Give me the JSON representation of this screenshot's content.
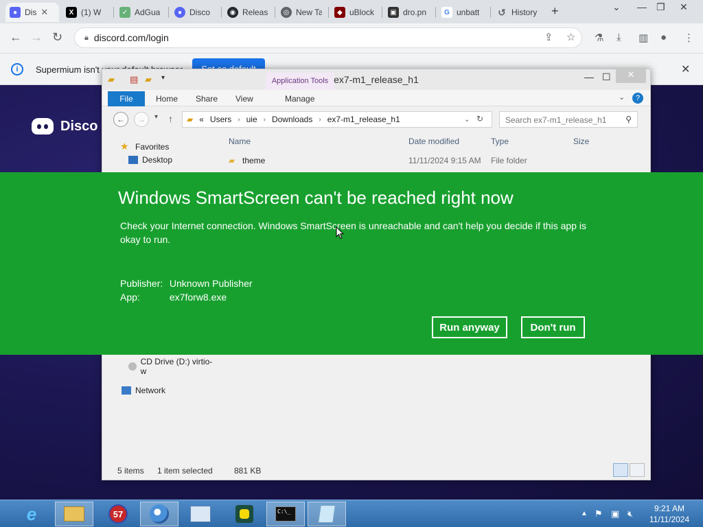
{
  "browser": {
    "tabs": [
      {
        "label": "Dis",
        "favicon_color": "#5865f2",
        "active": true
      },
      {
        "label": "(1) W",
        "favicon_color": "#000000"
      },
      {
        "label": "AdGua",
        "favicon_color": "#67b279"
      },
      {
        "label": "Disco",
        "favicon_color": "#5865f2"
      },
      {
        "label": "Releas",
        "favicon_color": "#24292f"
      },
      {
        "label": "New Ta",
        "favicon_color": "#5f6368"
      },
      {
        "label": "uBlock",
        "favicon_color": "#800000"
      },
      {
        "label": "dro.pn",
        "favicon_color": "#333333"
      },
      {
        "label": "unbatt",
        "favicon_color": "#4285f4"
      },
      {
        "label": "History",
        "favicon_color": "#5f6368"
      }
    ],
    "url": "discord.com/login",
    "infobar": {
      "message": "Supermium isn't your default browser",
      "button": "Set as default"
    }
  },
  "discord": {
    "logo_text": "Disco"
  },
  "explorer": {
    "title": "ex7-m1_release_h1",
    "context_tab": "Application Tools",
    "ribbon_tabs": [
      "File",
      "Home",
      "Share",
      "View",
      "Manage"
    ],
    "breadcrumb": [
      "«",
      "Users",
      "uie",
      "Downloads",
      "ex7-m1_release_h1"
    ],
    "search_placeholder": "Search ex7-m1_release_h1",
    "nav": {
      "favorites": "Favorites",
      "desktop": "Desktop",
      "cd_drive": "CD Drive (D:) virtio-w",
      "network": "Network"
    },
    "columns": [
      "Name",
      "Date modified",
      "Type",
      "Size"
    ],
    "files": [
      {
        "name": "theme",
        "date": "11/11/2024 9:15 AM",
        "type": "File folder",
        "size": ""
      }
    ],
    "status": {
      "items": "5 items",
      "selected": "1 item selected",
      "size": "881 KB"
    }
  },
  "smartscreen": {
    "title": "Windows SmartScreen can't be reached right now",
    "body": "Check your Internet connection. Windows SmartScreen is unreachable and can't help you decide if this app is okay to run.",
    "publisher_label": "Publisher:",
    "publisher_value": "Unknown Publisher",
    "app_label": "App:",
    "app_value": "ex7forw8.exe",
    "run_anyway": "Run anyway",
    "dont_run": "Don't run"
  },
  "taskbar": {
    "badge": "57",
    "time": "9:21 AM",
    "date": "11/11/2024"
  },
  "colors": {
    "smartscreen_green": "#18a02f",
    "discord_bg": "#1b1650",
    "chrome_blue": "#1a73e8",
    "ribbon_file": "#1979ca"
  }
}
